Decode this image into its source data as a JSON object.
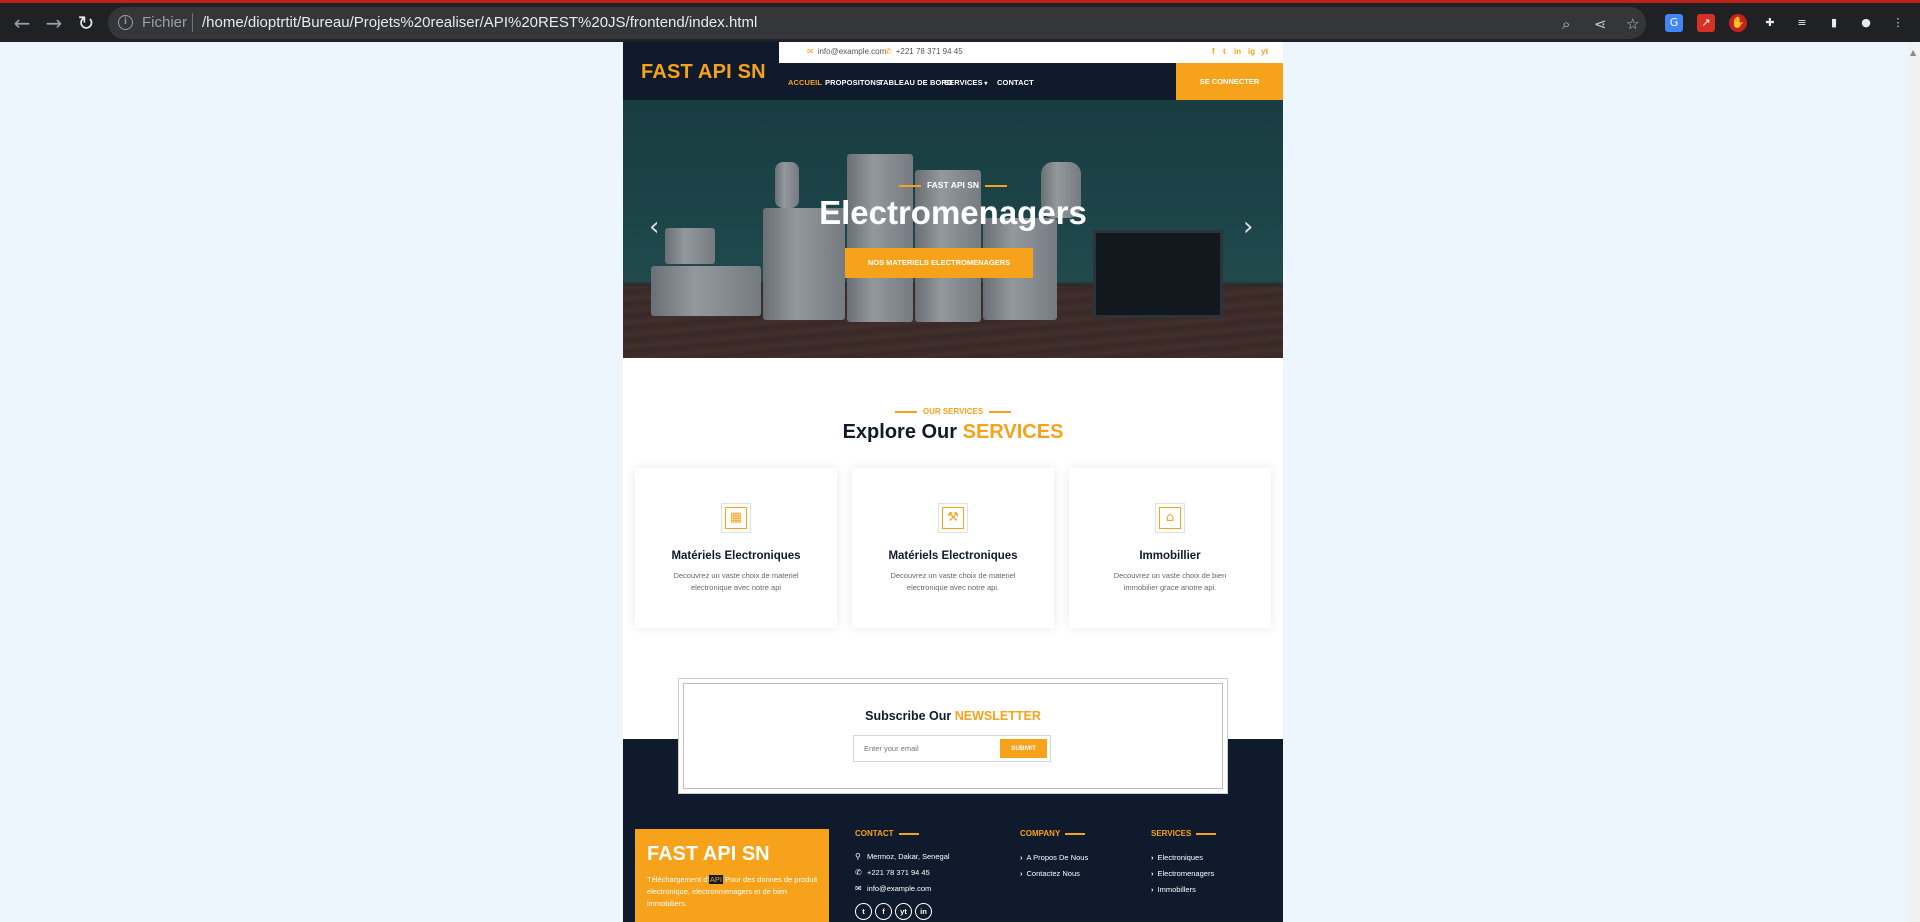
{
  "browser": {
    "scheme_label": "Fichier",
    "url": "/home/dioptrtit/Bureau/Projets%20realiser/API%20REST%20JS/frontend/index.html"
  },
  "header": {
    "logo": "FAST API SN",
    "email": "info@example.com",
    "phone": "+221 78 371 94 45",
    "social": [
      "f",
      "t",
      "in",
      "ig",
      "yt"
    ],
    "nav": [
      "ACCUEIL",
      "PROPOSITONS",
      "TABLEAU DE BORD",
      "SERVICES",
      "CONTACT"
    ],
    "login": "SE CONNECTER"
  },
  "hero": {
    "kicker": "FAST API SN",
    "title": "Electromenagers",
    "button": "NOS MATERIELS ELECTROMENAGERS"
  },
  "services": {
    "kicker": "OUR SERVICES",
    "title_prefix": "Explore Our",
    "title_accent": "SERVICES",
    "cards": [
      {
        "icon": "building-icon",
        "title": "Matériels Electroniques",
        "desc": "Decouvrez un vaste choix de materiel electronique avec notre api"
      },
      {
        "icon": "utensils-icon",
        "title": "Matériels Electroniques",
        "desc": "Decouvrez un vaste choix de materiel electronique avec notre api."
      },
      {
        "icon": "landmark-icon",
        "title": "Immobillier",
        "desc": "Decouvrez un vaste choix de bien immobilier grace anotre api."
      }
    ]
  },
  "newsletter": {
    "title_prefix": "Subscribe Our",
    "title_accent": "NEWSLETTER",
    "placeholder": "Enter your email",
    "submit": "SUBMIT"
  },
  "footer": {
    "logo": "FAST API SN",
    "desc_before": "Téléchargement d'",
    "desc_highlight": "API",
    "desc_after": " Pour des donnes de produit electronique, electronmenagers et de bien immobiliers.",
    "contact": {
      "heading": "CONTACT",
      "address": "Mermoz, Dakar, Senegal",
      "phone": "+221 78 371 94 45",
      "email": "info@example.com"
    },
    "company": {
      "heading": "COMPANY",
      "links": [
        "A Propos De Nous",
        "Contactez Nous"
      ]
    },
    "services": {
      "heading": "SERVICES",
      "links": [
        "Electroniques",
        "Electromenagers",
        "Immobillers"
      ]
    },
    "social": [
      "t",
      "f",
      "yt",
      "in"
    ]
  },
  "colors": {
    "accent": "#f7a21b",
    "dark": "#0f1a2c",
    "page_bg": "#eef6fd"
  }
}
